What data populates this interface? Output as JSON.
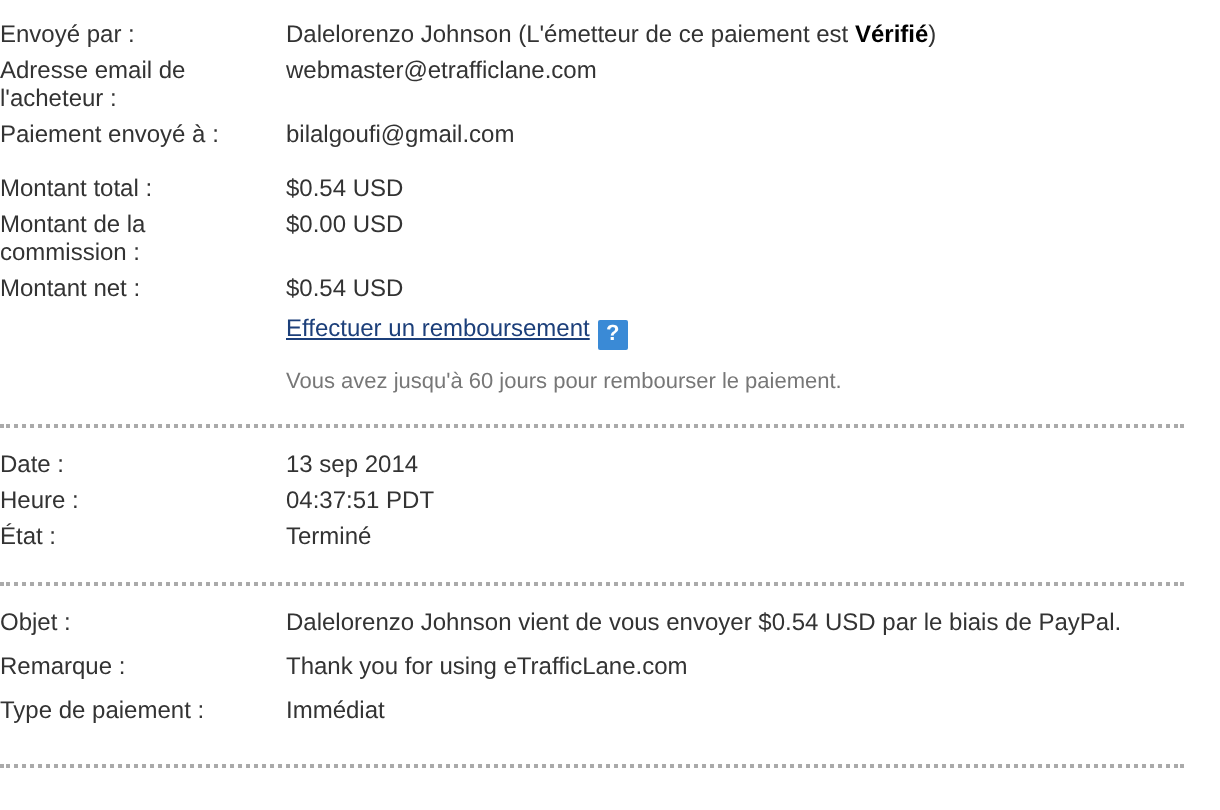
{
  "sections": [
    {
      "groups": [
        {
          "rows": [
            {
              "label": "Envoyé par :",
              "value": "Dalelorenzo Johnson (L'émetteur de ce paiement est **Vérifié**)"
            },
            {
              "label": "Adresse email de l'acheteur :",
              "value": "webmaster@etrafficlane.com"
            },
            {
              "label": "Paiement envoyé à :",
              "value": "bilalgoufi@gmail.com"
            }
          ]
        },
        {
          "rows": [
            {
              "label": "Montant total :",
              "value": "$0.54 USD"
            },
            {
              "label": "Montant de la commission :",
              "value": "$0.00 USD"
            },
            {
              "label": "Montant net :",
              "value": "$0.54 USD"
            }
          ],
          "refund_link": "Effectuer un remboursement",
          "help": "?",
          "note": "Vous avez jusqu'à 60 jours pour rembourser le paiement."
        }
      ]
    },
    {
      "groups": [
        {
          "rows": [
            {
              "label": "Date :",
              "value": "13 sep 2014"
            },
            {
              "label": "Heure :",
              "value": "04:37:51 PDT"
            },
            {
              "label": "État :",
              "value": "Terminé"
            }
          ]
        }
      ]
    },
    {
      "groups": [
        {
          "rows": [
            {
              "label": "Objet :",
              "value": "Dalelorenzo Johnson vient de vous envoyer $0.54 USD par le biais de PayPal."
            },
            {
              "label": "Remarque :",
              "value": "Thank you for using eTrafficLane.com"
            },
            {
              "label": "Type de paiement :",
              "value": "Immédiat"
            }
          ]
        }
      ]
    }
  ]
}
